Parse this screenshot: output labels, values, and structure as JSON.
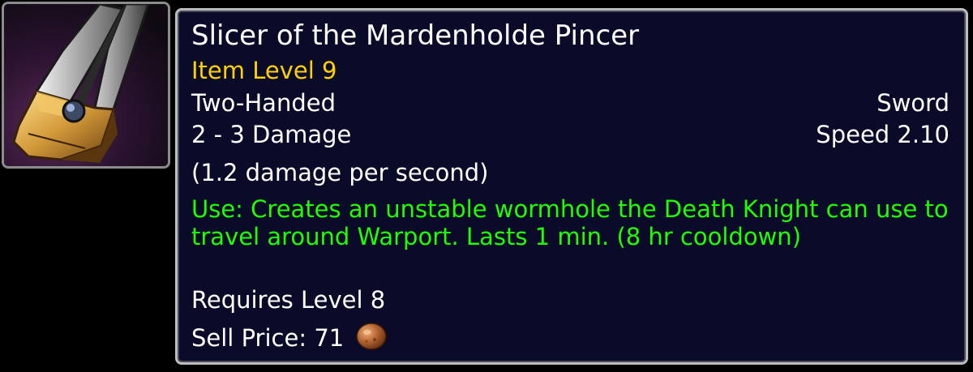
{
  "item": {
    "icon_name": "sword-pincer-icon",
    "name": "Slicer of the Mardenholde Pincer",
    "item_level": "Item Level 9",
    "hands": "Two-Handed",
    "weapon_type": "Sword",
    "damage": "2 - 3 Damage",
    "speed": "Speed 2.10",
    "dps": "(1.2 damage per second)",
    "use_effect": "Use: Creates an unstable wormhole the Death Knight can use to travel around Warport. Lasts 1 min. (8 hr cooldown)",
    "requires": "Requires Level 8",
    "sell_label": "Sell Price:",
    "sell_amount": "71",
    "currency_icon": "copper-coin-icon"
  },
  "colors": {
    "background": "#000000",
    "tooltip_bg": "#0a0b28",
    "tooltip_border": "#bdbdbd",
    "title": "#ffffff",
    "item_level": "#ffd100",
    "use_effect": "#1eff00",
    "text": "#ffffff",
    "coin": "#b0622e"
  }
}
